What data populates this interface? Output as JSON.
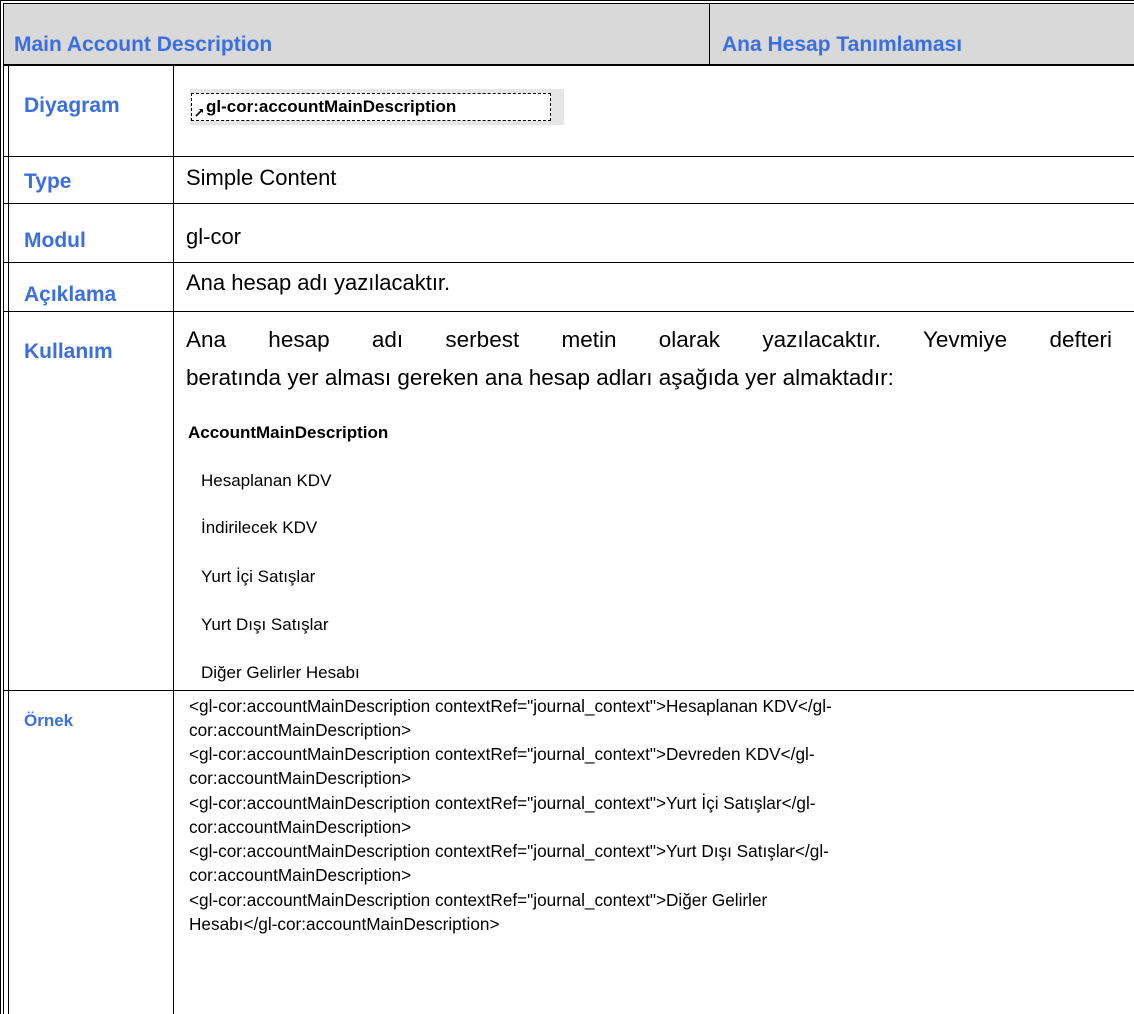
{
  "header": {
    "left_title": "Main Account Description",
    "right_title": "Ana Hesap Tanımlaması"
  },
  "rows": {
    "diagram": {
      "label": "Diyagram",
      "element": "gl-cor:accountMainDescription",
      "icon": "link-arrow-icon"
    },
    "type": {
      "label": "Type",
      "value": "Simple Content"
    },
    "module": {
      "label": "Modul",
      "value": "gl-cor"
    },
    "description": {
      "label": "Açıklama",
      "value": "Ana hesap adı yazılacaktır."
    },
    "usage": {
      "label": "Kullanım",
      "line1": "Ana hesap adı serbest metin olarak yazılacaktır. Yevmiye defteri",
      "line2": "beratında yer alması gereken ana hesap adları aşağıda yer almaktadır:",
      "list_title": "AccountMainDescription",
      "items": [
        "Hesaplanan KDV",
        "İndirilecek KDV",
        "Yurt İçi Satışlar",
        "Yurt Dışı Satışlar",
        "Diğer Gelirler Hesabı"
      ]
    },
    "example": {
      "label": "Örnek",
      "lines": [
        "<gl-cor:accountMainDescription contextRef=\"journal_context\">Hesaplanan KDV</gl-",
        "cor:accountMainDescription>",
        "<gl-cor:accountMainDescription contextRef=\"journal_context\">Devreden KDV</gl-",
        "cor:accountMainDescription>",
        "<gl-cor:accountMainDescription contextRef=\"journal_context\">Yurt İçi Satışlar</gl-",
        "cor:accountMainDescription>",
        "<gl-cor:accountMainDescription contextRef=\"journal_context\">Yurt Dışı Satışlar</gl-",
        "cor:accountMainDescription>",
        "<gl-cor:accountMainDescription contextRef=\"journal_context\">Diğer Gelirler",
        "Hesabı</gl-cor:accountMainDescription>"
      ]
    }
  },
  "colors": {
    "label_blue": "#3b6fe0",
    "header_gray": "#d9d9d9"
  }
}
